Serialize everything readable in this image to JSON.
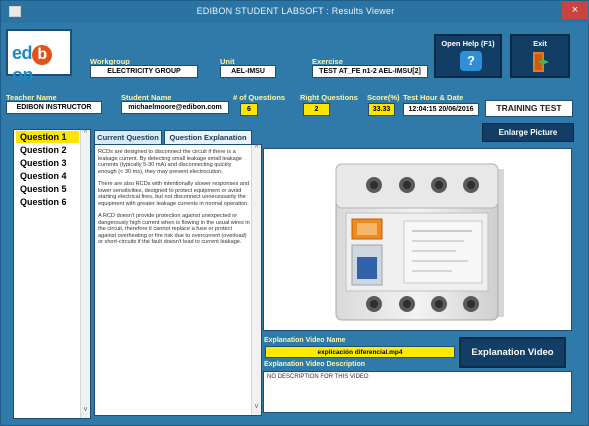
{
  "window": {
    "title": "EDIBON STUDENT LABSOFT : Results Viewer",
    "close_glyph": "×"
  },
  "logo": {
    "text_left": "ed",
    "text_o": "b",
    "text_right": "on"
  },
  "header": {
    "workgroup_label": "Workgroup",
    "workgroup_value": "ELECTRICITY GROUP",
    "unit_label": "Unit",
    "unit_value": "AEL-IMSU",
    "exercise_label": "Exercise",
    "exercise_value": "TEST AT_FE n1-2 AEL-IMSU[2]",
    "teacher_label": "Teacher Name",
    "teacher_value": "EDIBON INSTRUCTOR",
    "student_label": "Student Name",
    "student_value": "michaelmoore@edibon.com",
    "questions_label": "# of Questions",
    "questions_value": "6",
    "right_label": "Right Questions",
    "right_value": "2",
    "score_label": "Score(%)",
    "score_value": "33.33",
    "date_label": "Test Hour & Date",
    "date_value": "12:04:15 20/06/2016"
  },
  "buttons": {
    "open_help": "Open Help (F1)",
    "exit": "Exit",
    "training": "TRAINING TEST",
    "enlarge": "Enlarge Picture",
    "video": "Explanation Video"
  },
  "questions": [
    {
      "label": "Question 1",
      "active": true
    },
    {
      "label": "Question 2",
      "active": false
    },
    {
      "label": "Question 3",
      "active": false
    },
    {
      "label": "Question 4",
      "active": false
    },
    {
      "label": "Question 5",
      "active": false
    },
    {
      "label": "Question 6",
      "active": false
    }
  ],
  "tabs": {
    "current": "Current Question",
    "explanation": "Question Explanation"
  },
  "explanation": {
    "para1": "RCDs are designed to disconnect the circuit if there is a leakage current. By detecting small leakage small leakage currents (typically 5-30 mA) and disconnecting quickly enough (< 30 ms), they may prevent electrocution.",
    "para2": "There are also RCDs with intentionally slower responses and lower sensitivities, designed to protect equipment or avoid starting electrical fires, but not disconnect unnecessarily the equipment with greater leakage currents in normal operation.",
    "para3": "A RCD doesn't provide protection against unexpected or dangerously high current when is flowing in the usual wires in the circuit, therefore it cannot replace a fuse or protect against overheating or fire risk due to overcurrent (overload) or short-circuits if the fault doesn't lead to current leakage."
  },
  "video": {
    "name_label": "Explanation Video Name",
    "name_value": "explicación diferencial.mp4",
    "desc_label": "Explanation Video Description",
    "desc_value": "NO DESCRIPTION FOR THIS VIDEO"
  },
  "colors": {
    "accent_yellow": "#ffe400",
    "panel_blue": "#2f7aa8",
    "button_navy": "#123e66",
    "logo_orange": "#e2521b"
  }
}
